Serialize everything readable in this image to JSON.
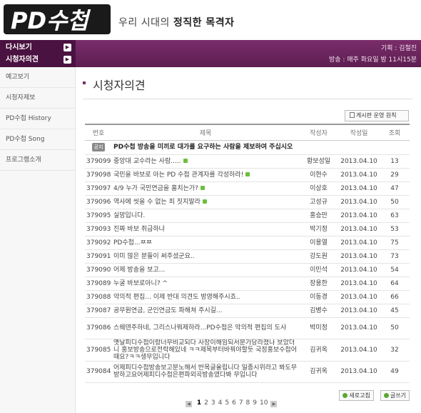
{
  "header": {
    "logo_text": "PD수첩",
    "tagline_prefix": "우리 시대의 ",
    "tagline_bold": "정직한 목격자"
  },
  "band": {
    "menu": [
      {
        "label": "다시보기"
      },
      {
        "label": "시청자의견"
      }
    ],
    "producer": "기획 : 김철진",
    "broadcast": "방송 : 매주 화요일 밤 11시15분"
  },
  "sidebar": {
    "items": [
      {
        "label": "예고보기"
      },
      {
        "label": "시청자제보"
      },
      {
        "label": "PD수첩 History"
      },
      {
        "label": "PD수첩 Song"
      },
      {
        "label": "프로그램소개"
      }
    ]
  },
  "main": {
    "title": "시청자의견",
    "notice_button": "게시판 운영 원칙",
    "columns": {
      "num": "번호",
      "subject": "제목",
      "author": "작성자",
      "date": "작성일",
      "views": "조회"
    },
    "notice": {
      "badge": "공지",
      "subject": "PD수첩 방송을 미끼로 대가를 요구하는 사람을 제보하여 주십시오"
    },
    "rows": [
      {
        "num": "379099",
        "subject": "중앙대 교수라는 사람.....",
        "comment": true,
        "author": "황보성일",
        "date": "2013.04.10",
        "views": "13"
      },
      {
        "num": "379098",
        "subject": "국민을 바보로 아는 PD 수첩 관계자를 각성하라!",
        "comment": true,
        "author": "이현수",
        "date": "2013.04.10",
        "views": "29"
      },
      {
        "num": "379097",
        "subject": "4/9 누가 국민연금을 훔치는가?",
        "comment": true,
        "author": "이상호",
        "date": "2013.04.10",
        "views": "47"
      },
      {
        "num": "379096",
        "subject": "역사에 씻을 수 없는 죄 짓지말라",
        "comment": true,
        "author": "고성규",
        "date": "2013.04.10",
        "views": "50"
      },
      {
        "num": "379095",
        "subject": "실망입니다.",
        "comment": false,
        "author": "홍승만",
        "date": "2013.04.10",
        "views": "63"
      },
      {
        "num": "379093",
        "subject": "진짜 바보 취급하냐",
        "comment": false,
        "author": "박기정",
        "date": "2013.04.10",
        "views": "53"
      },
      {
        "num": "379092",
        "subject": "PD수첩...ㅉㅉ",
        "comment": false,
        "author": "이용열",
        "date": "2013.04.10",
        "views": "75"
      },
      {
        "num": "379091",
        "subject": "이미 많은 분들이 써주셨군요..",
        "comment": false,
        "author": "강도원",
        "date": "2013.04.10",
        "views": "73"
      },
      {
        "num": "379090",
        "subject": "어제 방송을 보고...",
        "comment": false,
        "author": "이민석",
        "date": "2013.04.10",
        "views": "54"
      },
      {
        "num": "379089",
        "subject": "누굴 바보로아니? ^",
        "comment": false,
        "author": "장용한",
        "date": "2013.04.10",
        "views": "64"
      },
      {
        "num": "379088",
        "subject": "악의적 편집... 이제 반대 의견도 방영해주시죠..",
        "comment": false,
        "author": "이동경",
        "date": "2013.04.10",
        "views": "66"
      },
      {
        "num": "379087",
        "subject": "공무원연금, 군인연금도 파해쳐 주시길...",
        "comment": false,
        "author": "김병수",
        "date": "2013.04.10",
        "views": "45"
      },
      {
        "num": "379086",
        "subject": "스웨덴주하네, 그리스나뭐제하라...PD수첩은 악의적 편집의 도사",
        "comment": false,
        "author": "박미정",
        "date": "2013.04.10",
        "views": "50",
        "tall": true
      },
      {
        "num": "379085",
        "subject": "옛날피디수첩이랑너무비교되다 사장이해임되서분가당라졌나 보았더니 홍보방송으로전락해있네 ㅋㅋ제목부터바꿔야할듯 국정홍보수첩어때요?ㅋㅋ생무입니다",
        "comment": false,
        "author": "김귀옥",
        "date": "2013.04.10",
        "views": "32",
        "tall": true
      },
      {
        "num": "379084",
        "subject": "어제피디수첩방송보고분노해서 반목글올립니다 일종시위라고 봐도무방하고요어제피디수첩은편파외곡방송였다봐 무입니다",
        "comment": false,
        "author": "김귀옥",
        "date": "2013.04.10",
        "views": "49",
        "tall": true
      }
    ],
    "buttons": {
      "refresh": "새로고침",
      "write": "글쓰기"
    },
    "pagination": {
      "pages": [
        "1",
        "2",
        "3",
        "4",
        "5",
        "6",
        "7",
        "8",
        "9",
        "10"
      ],
      "current": "1"
    }
  }
}
